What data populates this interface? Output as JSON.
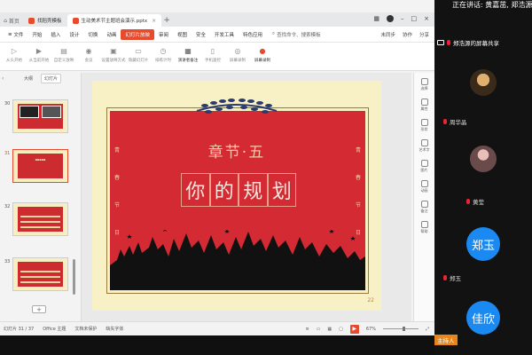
{
  "window": {
    "tabs": [
      {
        "label": "首页",
        "color": "#7a7a7a"
      },
      {
        "label": "找稻壳模板",
        "color": "#e84a2e"
      },
      {
        "label": "生动美术节主题班会演示.pptx",
        "color": "#e84a2e"
      }
    ]
  },
  "menu": {
    "file": "文件",
    "items": [
      "开始",
      "插入",
      "设计",
      "切换",
      "动画",
      "幻灯片放映",
      "审阅",
      "视图",
      "安全",
      "开发工具",
      "特色应用"
    ],
    "active_index": 5,
    "search": "查找命令、搜索模板",
    "right": [
      "未同步",
      "协作",
      "分享"
    ]
  },
  "ribbon": [
    "从头开始",
    "从当前开始",
    "自定义放映",
    "会议",
    "设置放映方式",
    "隐藏幻灯片",
    "排练计时",
    "演讲者备注",
    "手机遥控",
    "屏幕录制",
    "屏幕录制"
  ],
  "left_panel": {
    "tabs": [
      "大纲",
      "幻灯片"
    ],
    "slide_numbers": [
      "30",
      "31",
      "32",
      "33"
    ],
    "add_label": "+"
  },
  "slide": {
    "chapter": "章节·五",
    "title_chars": [
      "你",
      "的",
      "规",
      "划"
    ],
    "side_left": [
      "青",
      "春",
      "节",
      "日"
    ],
    "side_right": [
      "青",
      "春",
      "节",
      "日"
    ],
    "page_number": "22",
    "colors": {
      "red": "#d42a33",
      "cream": "#f8f1c6",
      "gold": "#9a7a3a"
    }
  },
  "right_toolbar": [
    "选择",
    "属性",
    "形状",
    "艺术字",
    "图片",
    "动画",
    "备注",
    "帮助"
  ],
  "status": {
    "slide_info": "幻灯片 31 / 37",
    "theme": "Office 主题",
    "protect": "文档未保护",
    "missing_font": "缺失字体",
    "zoom": "67%"
  },
  "meeting": {
    "speaking": "正在讲话: 黄嘉茁, 郑浩源",
    "share_label": "郑浩源的屏幕共享",
    "participants": [
      {
        "name": "周华晶"
      },
      {
        "name": "黄莹"
      },
      {
        "name": "郑玉",
        "initials": "郑玉"
      },
      {
        "name": "佳欣",
        "initials": "佳欣"
      }
    ],
    "host_badge": "主持人"
  }
}
